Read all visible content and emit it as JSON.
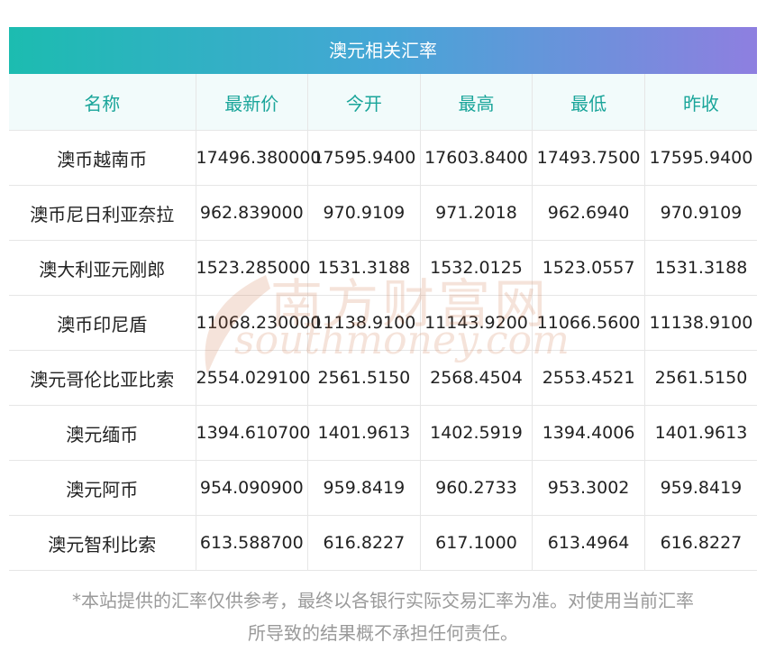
{
  "table": {
    "title": "澳元相关汇率",
    "headers": [
      "名称",
      "最新价",
      "今开",
      "最高",
      "最低",
      "昨收"
    ],
    "rows": [
      [
        "澳币越南币",
        "17496.380000",
        "17595.9400",
        "17603.8400",
        "17493.7500",
        "17595.9400"
      ],
      [
        "澳币尼日利亚奈拉",
        "962.839000",
        "970.9109",
        "971.2018",
        "962.6940",
        "970.9109"
      ],
      [
        "澳大利亚元刚郎",
        "1523.285000",
        "1531.3188",
        "1532.0125",
        "1523.0557",
        "1531.3188"
      ],
      [
        "澳币印尼盾",
        "11068.230000",
        "11138.9100",
        "11143.9200",
        "11066.5600",
        "11138.9100"
      ],
      [
        "澳元哥伦比亚比索",
        "2554.029100",
        "2561.5150",
        "2568.4504",
        "2553.4521",
        "2561.5150"
      ],
      [
        "澳元缅币",
        "1394.610700",
        "1401.9613",
        "1402.5919",
        "1394.4006",
        "1401.9613"
      ],
      [
        "澳元阿币",
        "954.090900",
        "959.8419",
        "960.2733",
        "953.3002",
        "959.8419"
      ],
      [
        "澳元智利比索",
        "613.588700",
        "616.8227",
        "617.1000",
        "613.4964",
        "616.8227"
      ]
    ]
  },
  "watermark": {
    "cn": "南方财富网",
    "en": "southmoney.com"
  },
  "footnote": {
    "line1": "*本站提供的汇率仅供参考，最终以各银行实际交易汇率为准。对使用当前汇率",
    "line2": "所导致的结果概不承担任何责任。"
  },
  "colors": {
    "header_gradient": [
      "#1cbcb0",
      "#45a6d6",
      "#8e7fe0"
    ],
    "header_text": "#1aa59a",
    "watermark": "#cc6a3a"
  }
}
